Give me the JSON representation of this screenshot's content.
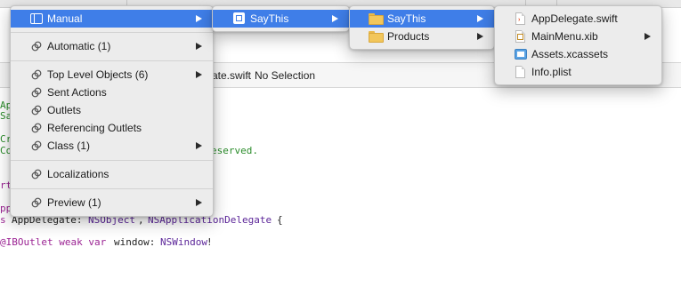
{
  "editor": {
    "jumpbar": {
      "file": "ate.swift",
      "selection": "No Selection"
    },
    "code_lines": [
      {
        "text": "Ap",
        "color": "green"
      },
      {
        "text": "Sa",
        "color": "green"
      },
      {
        "text": "Cr",
        "color": "green"
      },
      {
        "text": "Co",
        "color": "green"
      },
      {
        "text": "eserved.",
        "color": "green"
      },
      {
        "text": "rt",
        "color": "purple"
      },
      {
        "text": "pp",
        "color": "purple"
      },
      {
        "text": "s",
        "color": "purple"
      },
      {
        "text": "AppDelegate:",
        "color": "plain"
      },
      {
        "text": "NSObject",
        "color": "type"
      },
      {
        "text": ",",
        "color": "plain"
      },
      {
        "text": "NSApplicationDelegate",
        "color": "type"
      },
      {
        "text": "{",
        "color": "plain"
      },
      {
        "text": "@IBOutlet weak var",
        "color": "purple"
      },
      {
        "text": "window:",
        "color": "plain"
      },
      {
        "text": "NSWindow",
        "color": "type"
      },
      {
        "text": "!",
        "color": "plain"
      }
    ]
  },
  "menu_main": {
    "items": [
      {
        "label": "Manual",
        "icon": "manual-icon",
        "submenu": true,
        "selected": true
      },
      {
        "label": "Automatic (1)",
        "icon": "link-icon",
        "submenu": true
      },
      {
        "label": "Top Level Objects (6)",
        "icon": "link-icon",
        "submenu": true
      },
      {
        "label": "Sent Actions",
        "icon": "link-icon",
        "submenu": false
      },
      {
        "label": "Outlets",
        "icon": "link-icon",
        "submenu": false
      },
      {
        "label": "Referencing Outlets",
        "icon": "link-icon",
        "submenu": false
      },
      {
        "label": "Class (1)",
        "icon": "link-icon",
        "submenu": true
      },
      {
        "label": "Localizations",
        "icon": "link-icon",
        "submenu": false
      },
      {
        "label": "Preview (1)",
        "icon": "link-icon",
        "submenu": true
      }
    ]
  },
  "menu_project": {
    "items": [
      {
        "label": "SayThis",
        "icon": "xcode-project-icon",
        "submenu": true,
        "selected": true
      }
    ]
  },
  "menu_groups": {
    "items": [
      {
        "label": "SayThis",
        "icon": "folder-icon",
        "submenu": true,
        "selected": true
      },
      {
        "label": "Products",
        "icon": "folder-icon",
        "submenu": true
      }
    ]
  },
  "menu_files": {
    "items": [
      {
        "label": "AppDelegate.swift",
        "icon": "swift-file-icon",
        "submenu": false
      },
      {
        "label": "MainMenu.xib",
        "icon": "xib-file-icon",
        "submenu": true
      },
      {
        "label": "Assets.xcassets",
        "icon": "asset-catalog-icon",
        "submenu": false
      },
      {
        "label": "Info.plist",
        "icon": "plist-file-icon",
        "submenu": false
      }
    ]
  },
  "colors": {
    "selection": "#3f7ee8",
    "menu_background": "#ececec",
    "comment_green": "#2a8c2a",
    "keyword_purple": "#9b2393",
    "type_purple": "#5c2699"
  }
}
